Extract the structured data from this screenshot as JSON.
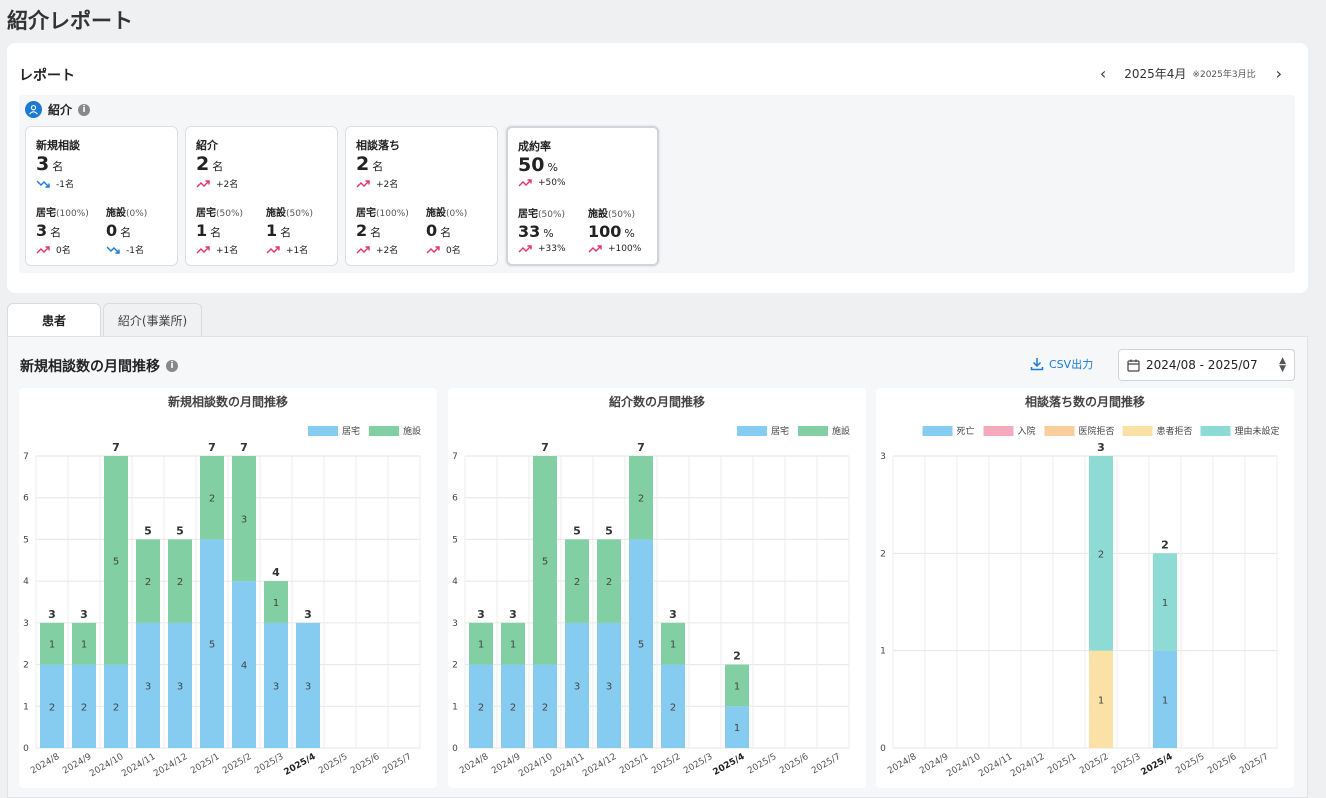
{
  "page": {
    "title": "紹介レポート"
  },
  "report": {
    "title": "レポート",
    "month": "2025年4月",
    "compare_note": "※2025年3月比",
    "section_label": "紹介",
    "metrics": [
      {
        "title": "新規相談",
        "value": "3",
        "unit": "名",
        "diff": "-1名",
        "trend": "down",
        "subs": [
          {
            "label": "居宅",
            "pct": "(100%)",
            "value": "3",
            "unit": "名",
            "diff": "0名",
            "trend": "up"
          },
          {
            "label": "施設",
            "pct": "(0%)",
            "value": "0",
            "unit": "名",
            "diff": "-1名",
            "trend": "down"
          }
        ]
      },
      {
        "title": "紹介",
        "value": "2",
        "unit": "名",
        "diff": "+2名",
        "trend": "up",
        "subs": [
          {
            "label": "居宅",
            "pct": "(50%)",
            "value": "1",
            "unit": "名",
            "diff": "+1名",
            "trend": "up"
          },
          {
            "label": "施設",
            "pct": "(50%)",
            "value": "1",
            "unit": "名",
            "diff": "+1名",
            "trend": "up"
          }
        ]
      },
      {
        "title": "相談落ち",
        "value": "2",
        "unit": "名",
        "diff": "+2名",
        "trend": "up",
        "subs": [
          {
            "label": "居宅",
            "pct": "(100%)",
            "value": "2",
            "unit": "名",
            "diff": "+2名",
            "trend": "up"
          },
          {
            "label": "施設",
            "pct": "(0%)",
            "value": "0",
            "unit": "名",
            "diff": "0名",
            "trend": "up"
          }
        ]
      },
      {
        "title": "成約率",
        "value": "50",
        "unit": "%",
        "diff": "+50%",
        "trend": "up",
        "subs": [
          {
            "label": "居宅",
            "pct": "(50%)",
            "value": "33",
            "unit": "%",
            "diff": "+33%",
            "trend": "up"
          },
          {
            "label": "施設",
            "pct": "(50%)",
            "value": "100",
            "unit": "%",
            "diff": "+100%",
            "trend": "up"
          }
        ]
      }
    ]
  },
  "tabs": [
    {
      "label": "患者",
      "active": true
    },
    {
      "label": "紹介(事業所)",
      "active": false
    }
  ],
  "content": {
    "title": "新規相談数の月間推移",
    "csv_label": "CSV出力",
    "date_range": "2024/08 - 2025/07"
  },
  "colors": {
    "blue": "#86cbf0",
    "green": "#82cfa4",
    "pink": "#f5a9bc",
    "orange": "#f9cd9c",
    "yellow": "#fbe1a6",
    "teal": "#8edbd6",
    "up": "#e0336a",
    "down": "#1a7ad4"
  },
  "chart_data": [
    {
      "type": "bar",
      "stacked": true,
      "title": "新規相談数の月間推移",
      "categories": [
        "2024/8",
        "2024/9",
        "2024/10",
        "2024/11",
        "2024/12",
        "2025/1",
        "2025/2",
        "2025/3",
        "2025/4",
        "2025/5",
        "2025/6",
        "2025/7"
      ],
      "highlight_category": "2025/4",
      "ylim": [
        0,
        7
      ],
      "legend": "top-right",
      "series": [
        {
          "name": "居宅",
          "color": "#86cbf0",
          "values": [
            2,
            2,
            2,
            3,
            3,
            5,
            4,
            3,
            3,
            0,
            0,
            0
          ]
        },
        {
          "name": "施設",
          "color": "#82cfa4",
          "values": [
            1,
            1,
            5,
            2,
            2,
            2,
            3,
            1,
            0,
            0,
            0,
            0
          ]
        }
      ],
      "totals": [
        3,
        3,
        7,
        5,
        5,
        7,
        7,
        4,
        3,
        null,
        null,
        null
      ]
    },
    {
      "type": "bar",
      "stacked": true,
      "title": "紹介数の月間推移",
      "categories": [
        "2024/8",
        "2024/9",
        "2024/10",
        "2024/11",
        "2024/12",
        "2025/1",
        "2025/2",
        "2025/3",
        "2025/4",
        "2025/5",
        "2025/6",
        "2025/7"
      ],
      "highlight_category": "2025/4",
      "ylim": [
        0,
        7
      ],
      "legend": "top-right",
      "series": [
        {
          "name": "居宅",
          "color": "#86cbf0",
          "values": [
            2,
            2,
            2,
            3,
            3,
            5,
            2,
            0,
            1,
            0,
            0,
            0
          ]
        },
        {
          "name": "施設",
          "color": "#82cfa4",
          "values": [
            1,
            1,
            5,
            2,
            2,
            2,
            1,
            0,
            1,
            0,
            0,
            0
          ]
        }
      ],
      "totals": [
        3,
        3,
        7,
        5,
        5,
        7,
        3,
        null,
        2,
        null,
        null,
        null
      ]
    },
    {
      "type": "bar",
      "stacked": true,
      "title": "相談落ち数の月間推移",
      "categories": [
        "2024/8",
        "2024/9",
        "2024/10",
        "2024/11",
        "2024/12",
        "2025/1",
        "2025/2",
        "2025/3",
        "2025/4",
        "2025/5",
        "2025/6",
        "2025/7"
      ],
      "highlight_category": "2025/4",
      "ylim": [
        0,
        3
      ],
      "legend": "top-right",
      "series": [
        {
          "name": "死亡",
          "color": "#86cbf0",
          "values": [
            0,
            0,
            0,
            0,
            0,
            0,
            0,
            0,
            1,
            0,
            0,
            0
          ]
        },
        {
          "name": "入院",
          "color": "#f5a9bc",
          "values": [
            0,
            0,
            0,
            0,
            0,
            0,
            0,
            0,
            0,
            0,
            0,
            0
          ]
        },
        {
          "name": "医院拒否",
          "color": "#f9cd9c",
          "values": [
            0,
            0,
            0,
            0,
            0,
            0,
            0,
            0,
            0,
            0,
            0,
            0
          ]
        },
        {
          "name": "患者拒否",
          "color": "#fbe1a6",
          "values": [
            0,
            0,
            0,
            0,
            0,
            0,
            1,
            0,
            0,
            0,
            0,
            0
          ]
        },
        {
          "name": "理由未設定",
          "color": "#8edbd6",
          "values": [
            0,
            0,
            0,
            0,
            0,
            0,
            2,
            0,
            1,
            0,
            0,
            0
          ]
        }
      ],
      "totals": [
        null,
        null,
        null,
        null,
        null,
        null,
        3,
        null,
        2,
        null,
        null,
        null
      ]
    }
  ]
}
